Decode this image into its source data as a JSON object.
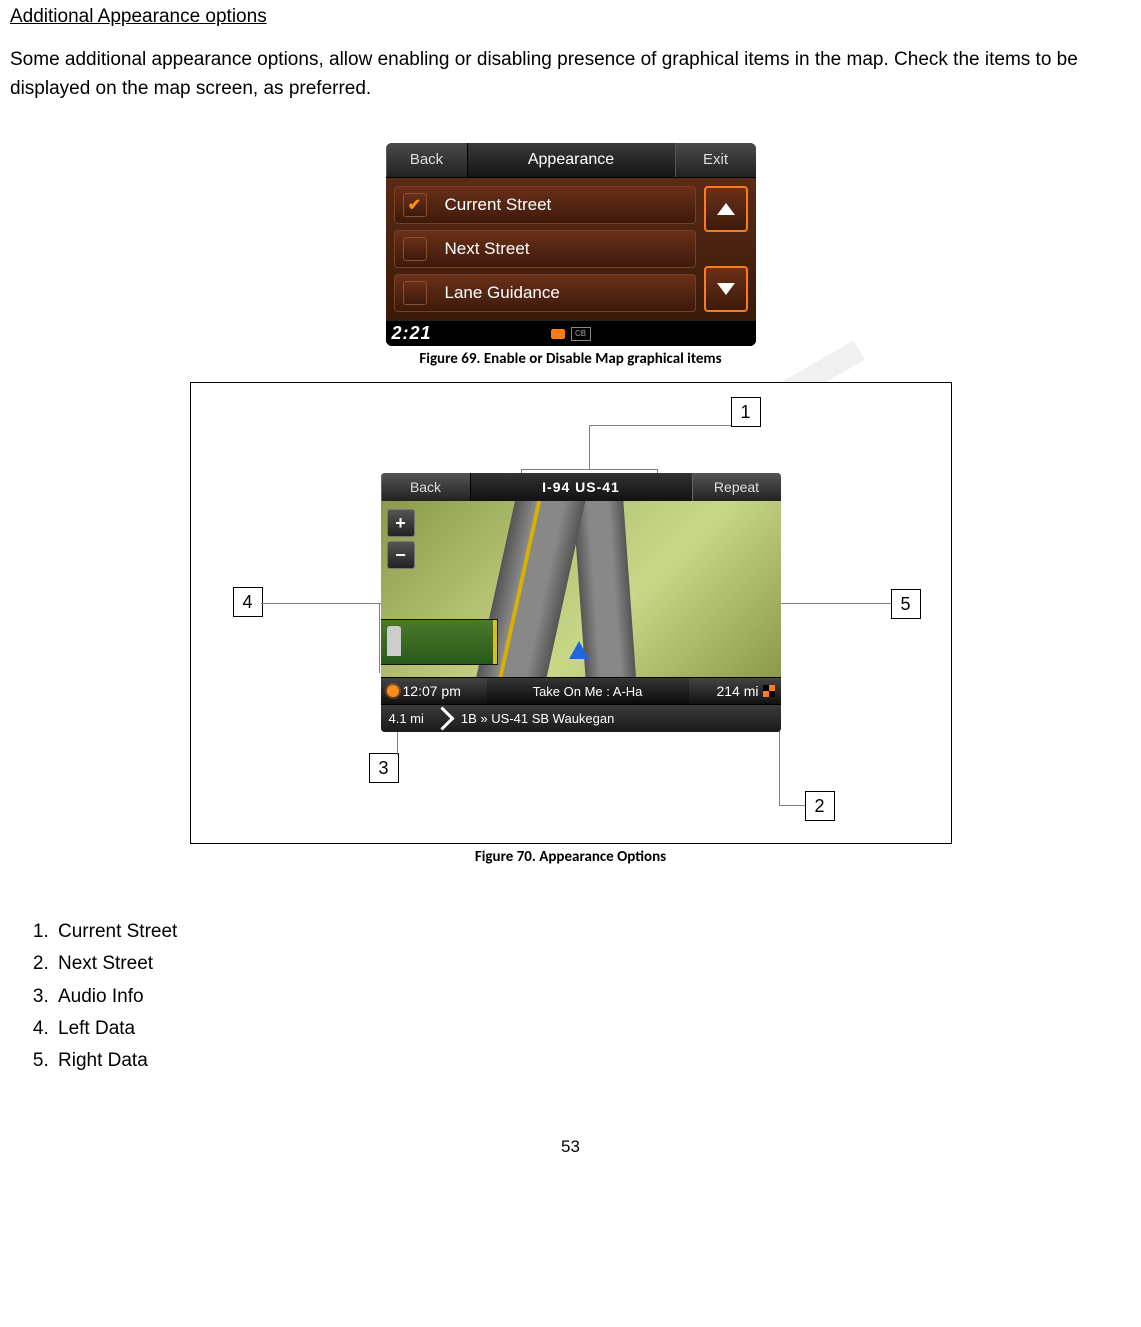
{
  "watermark": "DRAFT",
  "section_title": "Additional Appearance options",
  "paragraph": "Some additional appearance options, allow enabling or disabling presence of graphical items in the map. Check the items to be displayed on the map screen, as preferred.",
  "fig69": {
    "caption": "Figure 69. Enable or Disable Map graphical items",
    "back": "Back",
    "title": "Appearance",
    "exit": "Exit",
    "rows": [
      {
        "label": "Current Street",
        "checked": true
      },
      {
        "label": "Next Street",
        "checked": false
      },
      {
        "label": "Lane Guidance",
        "checked": false
      }
    ],
    "time": "2:21",
    "cb": "CB"
  },
  "fig70": {
    "caption": "Figure 70. Appearance Options",
    "callouts": [
      "1",
      "2",
      "3",
      "4",
      "5"
    ],
    "back": "Back",
    "title": "I-94  US-41",
    "repeat": "Repeat",
    "bar1_left": "12:07 pm",
    "bar1_mid": "Take On Me : A-Ha",
    "bar1_right": "214 mi",
    "bar2_dist": "4.1 mi",
    "bar2_dest": "1B » US-41 SB Waukegan"
  },
  "legend": [
    "Current Street",
    "Next Street",
    "Audio Info",
    "Left Data",
    "Right Data"
  ],
  "page_number": "53"
}
